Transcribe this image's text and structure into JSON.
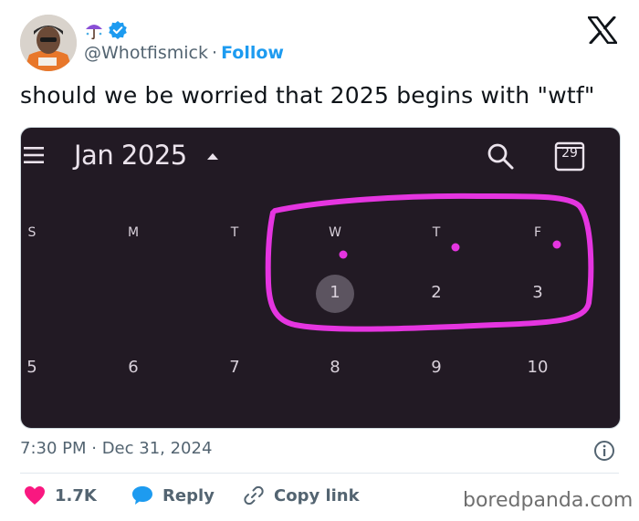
{
  "author": {
    "handle": "@Whotfismick",
    "follow_label": "Follow",
    "separator": "·",
    "name_emoji": "umbrella-with-rain-icon",
    "verified": true
  },
  "tweet": {
    "text": "should we be worried that 2025 begins with \"wtf\""
  },
  "calendar": {
    "month_label": "Jan 2025",
    "today_number": "29",
    "weekdays": [
      "S",
      "M",
      "T",
      "W",
      "T",
      "F"
    ],
    "row1": [
      "1",
      "2",
      "3"
    ],
    "row2": [
      "5",
      "6",
      "7",
      "8",
      "9",
      "10"
    ],
    "highlight_color": "#e535e0",
    "background_color": "#221a24"
  },
  "meta": {
    "timestamp": "7:30 PM · Dec 31, 2024"
  },
  "actions": {
    "likes": "1.7K",
    "reply_label": "Reply",
    "copy_label": "Copy link"
  },
  "watermark": "boredpanda.com",
  "colors": {
    "link": "#1d9bf0",
    "like": "#f91880",
    "muted": "#536471"
  }
}
